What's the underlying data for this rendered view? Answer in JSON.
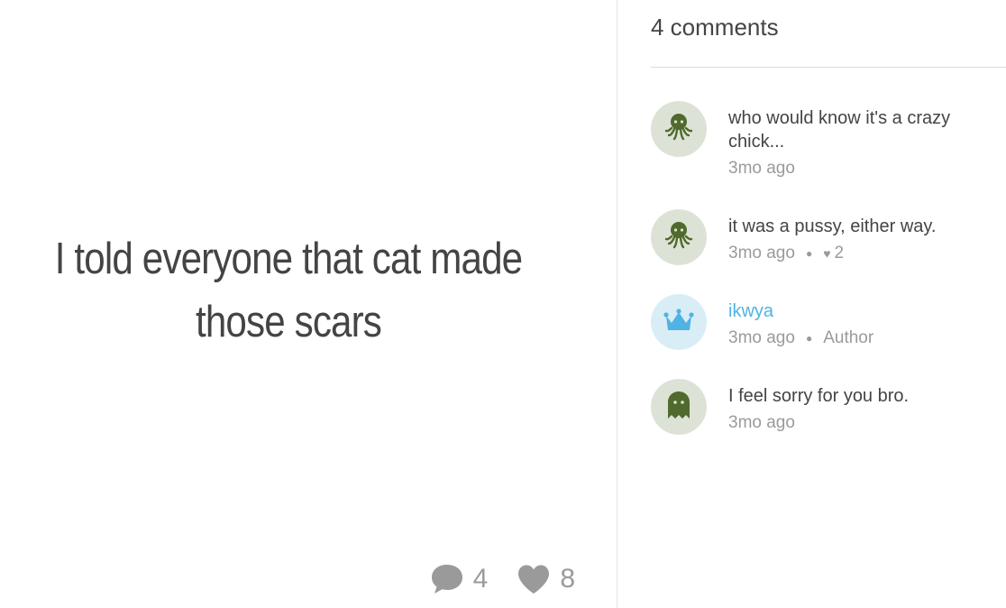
{
  "post": {
    "text": "I told everyone that cat made\nthose scars",
    "stats": {
      "comments_count": "4",
      "likes_count": "8"
    }
  },
  "comments_panel": {
    "header": "4 comments",
    "comments": [
      {
        "avatar": "octopus-icon",
        "text": "who would know it's a crazy chick...",
        "time": "3mo ago"
      },
      {
        "avatar": "octopus-icon",
        "text": "it was a pussy, either way.",
        "time": "3mo ago",
        "likes": "2"
      },
      {
        "avatar": "crown-icon",
        "author": "ikwya",
        "time": "3mo ago",
        "badge": "Author"
      },
      {
        "avatar": "ghost-icon",
        "text": "I feel sorry for you bro.",
        "time": "3mo ago"
      }
    ]
  },
  "colors": {
    "text": "#444444",
    "muted": "#9a9a9a",
    "author_link": "#4fb3e3",
    "avatar_green_bg": "#dde2d6",
    "avatar_green_fg": "#4f6a2c",
    "avatar_blue_bg": "#d9edf6",
    "avatar_blue_fg": "#4fb3e3"
  }
}
